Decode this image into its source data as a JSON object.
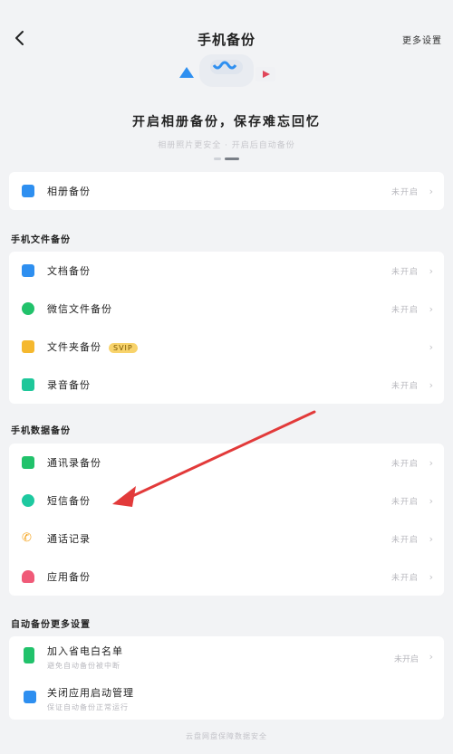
{
  "header": {
    "title": "手机备份",
    "more_settings": "更多设置"
  },
  "hero": {
    "title": "开启相册备份，保存难忘回忆",
    "subtitle": "相册照片更安全 · 开启后自动备份"
  },
  "album": {
    "label": "相册备份",
    "status": "未开启"
  },
  "files_section": {
    "title": "手机文件备份",
    "items": [
      {
        "label": "文档备份",
        "status": "未开启"
      },
      {
        "label": "微信文件备份",
        "status": "未开启"
      },
      {
        "label": "文件夹备份",
        "badge": "SVIP",
        "status": ""
      },
      {
        "label": "录音备份",
        "status": "未开启"
      }
    ]
  },
  "data_section": {
    "title": "手机数据备份",
    "items": [
      {
        "label": "通讯录备份",
        "status": "未开启"
      },
      {
        "label": "短信备份",
        "status": "未开启"
      },
      {
        "label": "通话记录",
        "status": "未开启"
      },
      {
        "label": "应用备份",
        "status": "未开启"
      }
    ]
  },
  "auto_section": {
    "title": "自动备份更多设置",
    "items": [
      {
        "label": "加入省电白名单",
        "sub": "避免自动备份被中断",
        "status": "未开启"
      },
      {
        "label": "关闭应用启动管理",
        "sub": "保证自动备份正常运行"
      }
    ]
  },
  "footer": {
    "text": "云盘网盘保障数据安全"
  },
  "colors": {
    "album_icon": "#2e8ff0",
    "doc_icon": "#2e8ff0",
    "wechat_icon": "#21c26b",
    "folder_icon": "#f5b82e",
    "record_icon": "#1ec79a",
    "contacts_icon": "#21c26b",
    "sms_icon": "#1ec9a0",
    "calls_icon": "#f5a623",
    "apps_icon": "#f05a78",
    "whitelist_icon": "#21c26b",
    "launch_icon": "#2e8ff0",
    "annotation_arrow": "#e23a3a"
  }
}
